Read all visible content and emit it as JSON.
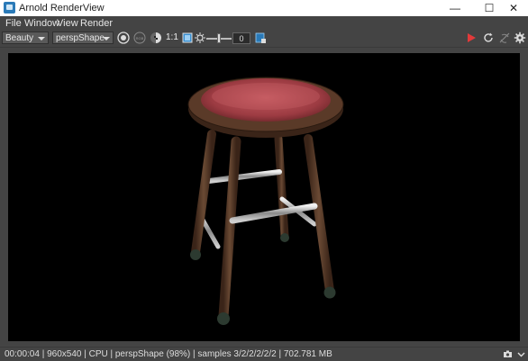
{
  "window": {
    "title": "Arnold RenderView",
    "controls": {
      "minimize": "—",
      "maximize": "☐",
      "close": "✕"
    }
  },
  "menubar": {
    "items": [
      "File",
      "Window",
      "View",
      "Render"
    ]
  },
  "toolbar": {
    "aov_select": "Beauty",
    "camera_select": "perspShape",
    "ratio_label": "1:1",
    "exposure_value": "0",
    "icons": [
      "display-settings-icon",
      "rgb-channel-icon",
      "alpha-channel-icon",
      "region-icon",
      "exposure-icon",
      "snapshot-icon",
      "render-play-icon",
      "refresh-icon",
      "ipr-icon",
      "settings-gear-icon"
    ],
    "colors": {
      "play": "#e23a3a",
      "accent": "#2a7ab8"
    }
  },
  "status": {
    "text": "00:00:04 | 960x540 | CPU | perspShape (98%) | samples 3/2/2/2/2/2 | 702.781 MB"
  },
  "render": {
    "description_icon": "stool-render-image",
    "background": "#000000"
  }
}
